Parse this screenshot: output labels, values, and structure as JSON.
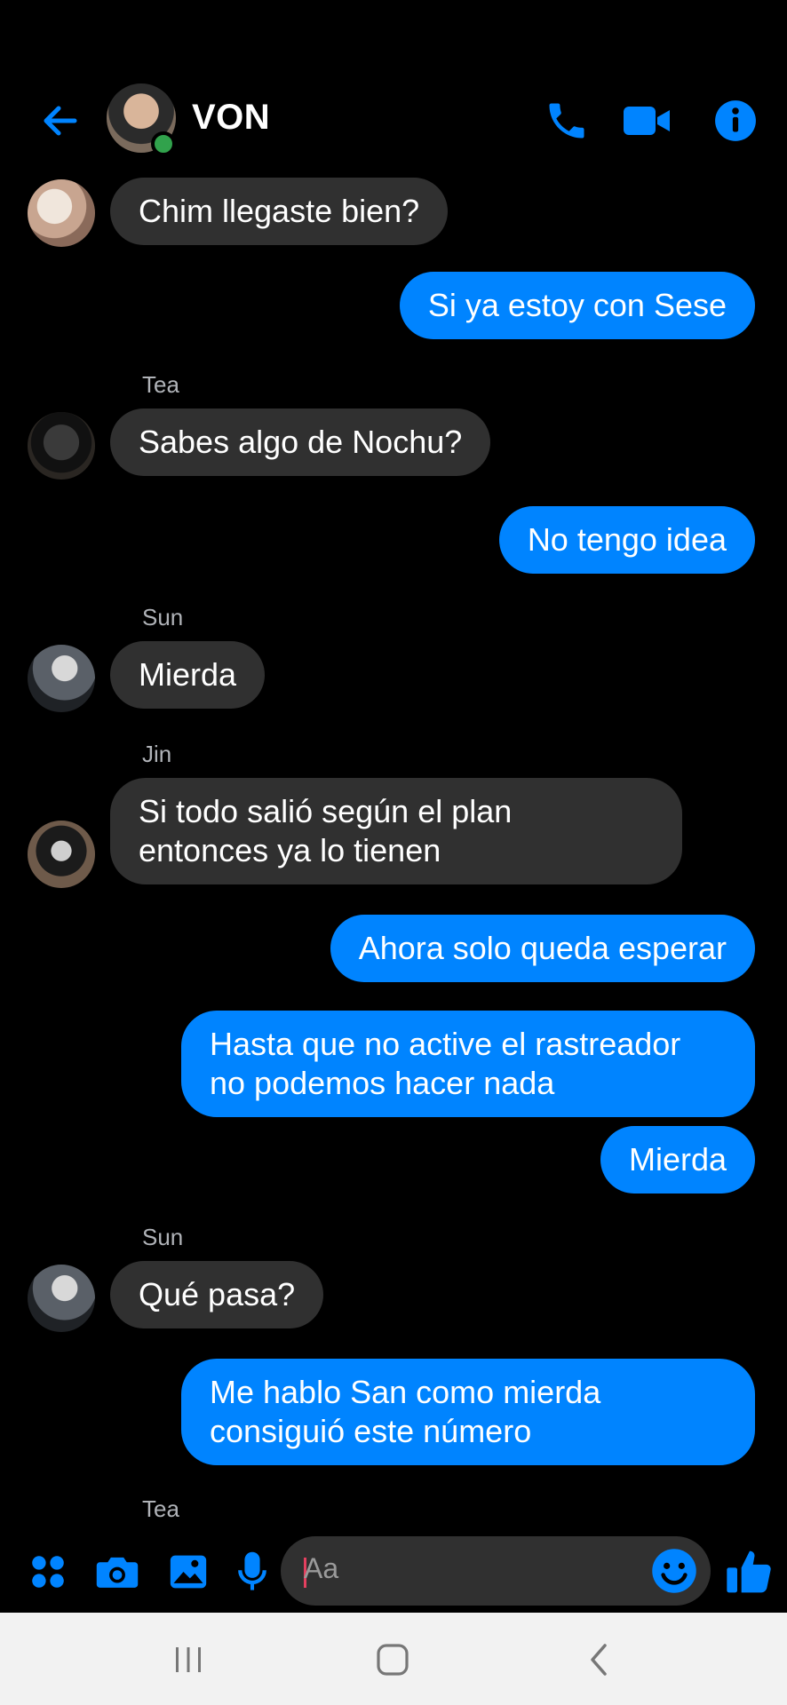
{
  "header": {
    "contact_name": "VON",
    "back_icon": "arrow-left-icon",
    "call_icon": "phone-icon",
    "video_icon": "video-camera-icon",
    "info_icon": "info-icon",
    "accent_color": "#0084ff",
    "online_color": "#31a24c"
  },
  "messages": [
    {
      "dir": "in",
      "text": "Chim llegaste bien?"
    },
    {
      "dir": "out",
      "text": "Si ya estoy con Sese"
    },
    {
      "dir": "in",
      "sender": "Tea",
      "text": "Sabes algo de Nochu?"
    },
    {
      "dir": "out",
      "text": "No tengo idea"
    },
    {
      "dir": "in",
      "sender": "Sun",
      "text": "Mierda"
    },
    {
      "dir": "in",
      "sender": "Jin",
      "text": "Si todo salió según el plan\nentonces ya lo tienen"
    },
    {
      "dir": "out",
      "text": "Ahora solo queda esperar"
    },
    {
      "dir": "out",
      "text": "Hasta que no active el rastreador\nno podemos hacer nada"
    },
    {
      "dir": "out",
      "text": "Mierda"
    },
    {
      "dir": "in",
      "sender": "Sun",
      "text": "Qué pasa?"
    },
    {
      "dir": "out",
      "text": "Me hablo San como mierda\nconsiguió este número"
    }
  ],
  "trailing_sender": "Tea",
  "composer": {
    "placeholder": "Aa",
    "menu_icon": "apps-grid-icon",
    "camera_icon": "camera-icon",
    "gallery_icon": "image-icon",
    "mic_icon": "microphone-icon",
    "emoji_icon": "smiley-icon",
    "like_icon": "thumbs-up-icon"
  },
  "navbar": {
    "recents_icon": "recents-icon",
    "home_icon": "home-icon",
    "back_icon": "back-chevron-icon"
  }
}
